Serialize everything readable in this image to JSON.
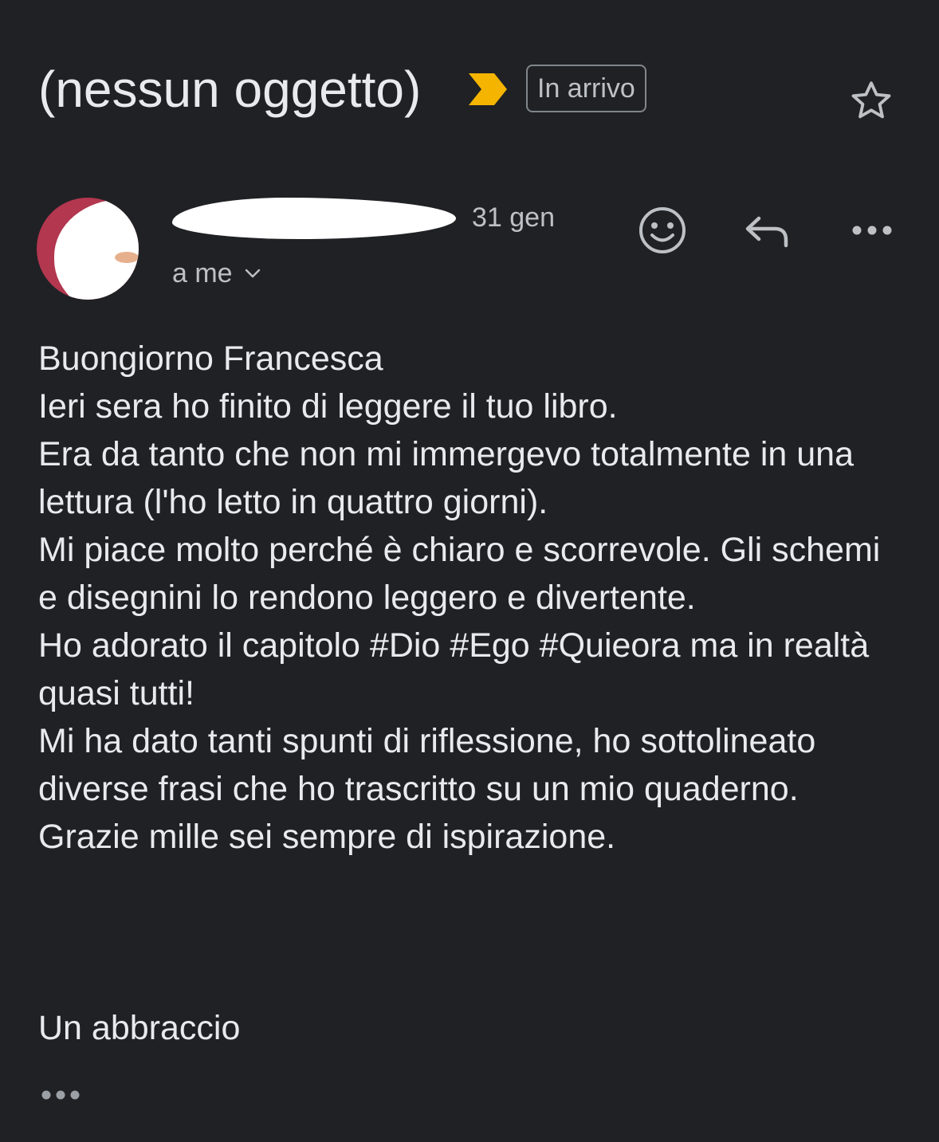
{
  "header": {
    "subject": "(nessun oggetto)",
    "label": "In arrivo",
    "importance_color": "#f4b400"
  },
  "message": {
    "sender_name": "",
    "date": "31 gen",
    "recipient": "a me",
    "body_lines": [
      "Buongiorno Francesca",
      "Ieri sera ho finito di leggere il tuo libro.",
      "Era da tanto che non mi immergevo totalmente in una lettura (l'ho letto in quattro giorni).",
      "Mi piace molto perché è chiaro e scorrevole. Gli schemi e disegnini lo rendono leggero e divertente.",
      "Ho adorato il capitolo #Dio #Ego #Quieora ma in realtà quasi tutti!",
      "Mi ha dato tanti spunti di riflessione, ho sottolineato diverse frasi che ho trascritto su un mio quaderno.",
      "Grazie mille sei sempre di ispirazione."
    ],
    "signoff": "Un abbraccio"
  },
  "icons": {
    "star": "star-icon",
    "emoji": "emoji-icon",
    "reply": "reply-icon",
    "more": "more-vert-icon",
    "chevron": "chevron-down-icon",
    "trimmed": "more-horiz-icon"
  },
  "colors": {
    "background": "#202124",
    "text": "#e8eaed",
    "secondary_text": "#bdc1c6",
    "icon": "#bdc1c6"
  }
}
